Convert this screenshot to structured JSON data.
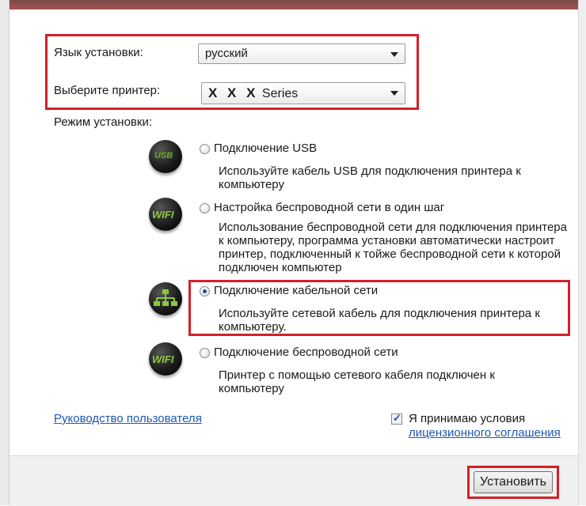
{
  "install_language": {
    "label": "Язык установки:",
    "value": "русский"
  },
  "printer": {
    "label": "Выберите принтер:",
    "value_prefix": "X X X",
    "value_suffix": "Series"
  },
  "mode_label": "Режим установки:",
  "options": [
    {
      "icon": "usb-icon",
      "icon_text": "USB",
      "title": "Подключение USB",
      "description": "Используйте кабель USB для подключения принтера к компьютеру",
      "checked": false
    },
    {
      "icon": "wifi-icon",
      "icon_text": "WIFI",
      "title": "Настройка беспроводной сети в один шаг",
      "description": "Использование беспроводной сети для подключения принтера к компьютеру, программа установки автоматически настроит принтер, подключенный к тойже беспроводной сети к которой подключен компьютер",
      "checked": false
    },
    {
      "icon": "network-icon",
      "icon_text": "",
      "title": "Подключение кабельной сети",
      "description": "Используйте сетевой кабель для подключения принтера к компьютеру.",
      "checked": true
    },
    {
      "icon": "wifi-icon",
      "icon_text": "WIFI",
      "title": "Подключение беспроводной сети",
      "description": "Принтер с помощью сетевого кабеля подключен к компьютеру",
      "checked": false
    }
  ],
  "user_guide_link": "Руководство пользователя",
  "license": {
    "accept_text": "Я принимаю условия",
    "link_text": "лицензионного соглашения",
    "checked": true
  },
  "install_button": "Установить",
  "colors": {
    "highlight": "#d3202a",
    "link": "#1f57b0",
    "titlebar": "#a35350"
  }
}
